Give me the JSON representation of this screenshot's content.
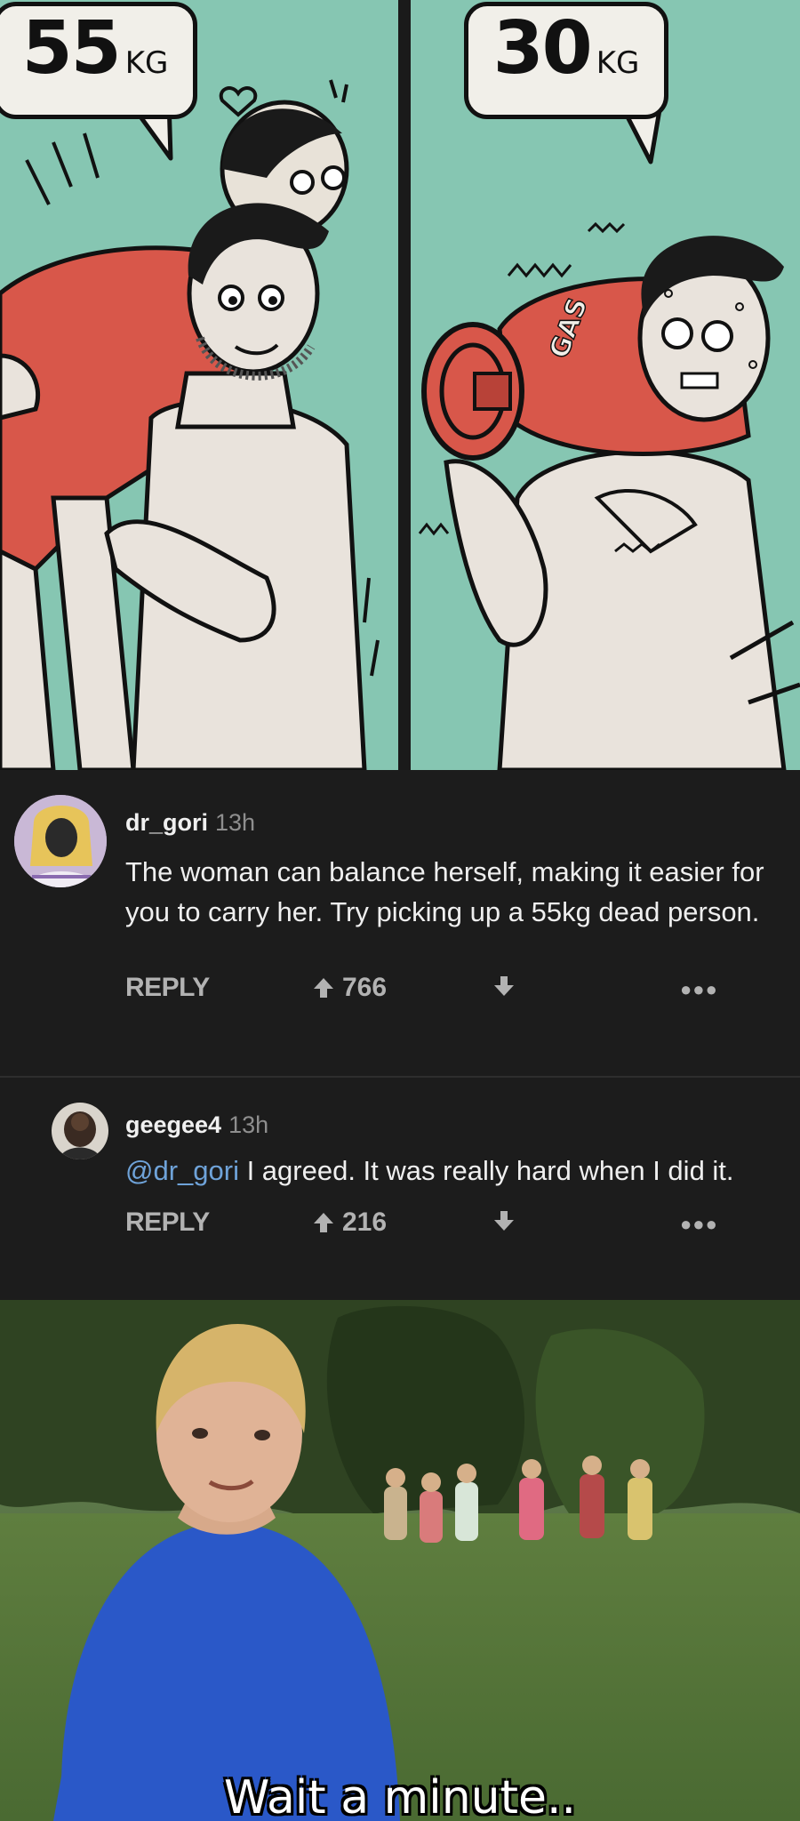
{
  "comic": {
    "left_bubble": {
      "number": "55",
      "unit": "KG"
    },
    "right_bubble": {
      "number": "30",
      "unit": "KG"
    },
    "tank_label": "GAS"
  },
  "comments": [
    {
      "username": "dr_gori",
      "time": "13h",
      "text": "The woman can balance herself, making it easier for you to carry her. Try picking up a 55kg dead person.",
      "reply_label": "REPLY",
      "votes": "766"
    },
    {
      "username": "geegee4",
      "time": "13h",
      "mention": "@dr_gori",
      "text": " I agreed. It was really hard when I did it.",
      "reply_label": "REPLY",
      "votes": "216"
    }
  ],
  "meme": {
    "caption": "Wait a minute.."
  },
  "colors": {
    "panel_bg": "#86c6b2",
    "comment_bg": "#1c1c1c",
    "mention": "#6fa3d9",
    "shirt": "#d8574a",
    "boy_shirt": "#2a58c8"
  },
  "icons": [
    "upvote-arrow-icon",
    "downvote-arrow-icon",
    "more-options-icon",
    "heart-icon"
  ]
}
